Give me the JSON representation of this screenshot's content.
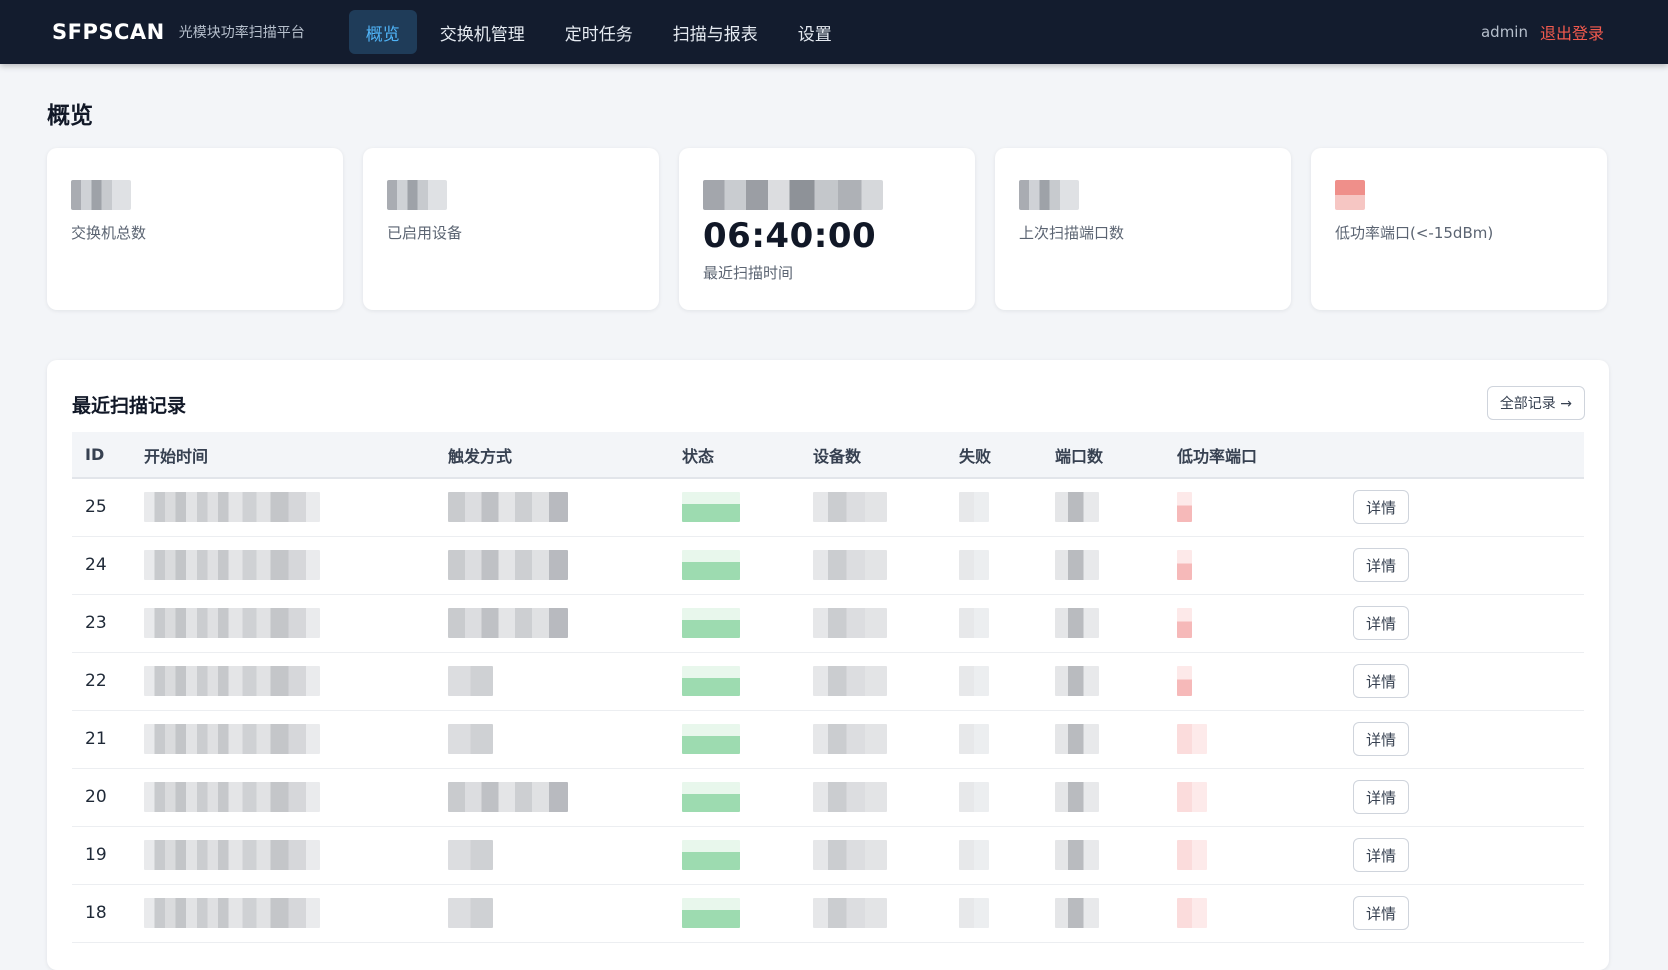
{
  "header": {
    "brand": "SFPSCAN",
    "subtitle": "光模块功率扫描平台",
    "nav": [
      {
        "label": "概览",
        "active": true
      },
      {
        "label": "交换机管理",
        "active": false
      },
      {
        "label": "定时任务",
        "active": false
      },
      {
        "label": "扫描与报表",
        "active": false
      },
      {
        "label": "设置",
        "active": false
      }
    ],
    "username": "admin",
    "logout_label": "退出登录"
  },
  "page": {
    "title": "概览"
  },
  "cards": [
    {
      "label": "交换机总数"
    },
    {
      "label": "已启用设备"
    },
    {
      "value": "06:40:00",
      "label": "最近扫描时间"
    },
    {
      "label": "上次扫描端口数"
    },
    {
      "label": "低功率端口(<-15dBm)"
    }
  ],
  "recent": {
    "title": "最近扫描记录",
    "all_records_label": "全部记录 →",
    "columns": [
      "ID",
      "开始时间",
      "触发方式",
      "状态",
      "设备数",
      "失败",
      "端口数",
      "低功率端口",
      ""
    ],
    "detail_label": "详情",
    "rows": [
      {
        "id": "25"
      },
      {
        "id": "24"
      },
      {
        "id": "23"
      },
      {
        "id": "22"
      },
      {
        "id": "21"
      },
      {
        "id": "20"
      },
      {
        "id": "19"
      },
      {
        "id": "18"
      }
    ]
  },
  "colors": {
    "nav_bg": "#131c2e",
    "nav_active_bg": "#1f3c59",
    "nav_active_text": "#4fb3f6",
    "logout": "#f25a4e",
    "page_bg": "#f3f5f8"
  }
}
